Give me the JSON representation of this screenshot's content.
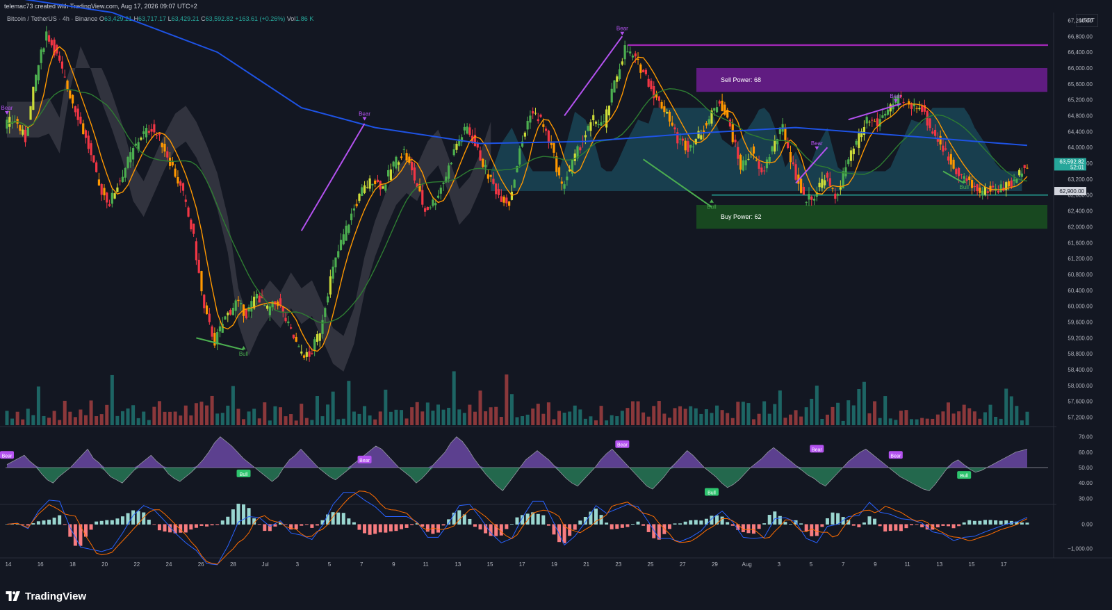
{
  "header": {
    "attribution": "telemac73 created with TradingView.com, Aug 17, 2026 09:07 UTC+2",
    "symbol": "Bitcoin / TetherUS · 4h · Binance",
    "open_label": "O",
    "open": "63,429.21",
    "high_label": "H",
    "high": "63,717.17",
    "low_label": "L",
    "low": "63,429.21",
    "close_label": "C",
    "close": "63,592.82",
    "change": "+163.61 (+0.26%)",
    "volume_label": "Vol",
    "volume": "1.86 K",
    "currency": "USDT"
  },
  "brand": {
    "name": "TradingView"
  },
  "colors": {
    "background": "#131722",
    "up": "#26a69a",
    "down": "#ef5350",
    "bull_candle": "#4caf50",
    "bear_candle": "#f23645",
    "ma_fast": "#ff9800",
    "ma_mid": "#2e7d32",
    "ma_slow": "#1e53e5",
    "divergence": "#b452f0",
    "sell_zone": "#7b1fa2",
    "buy_zone": "#1b5e20"
  },
  "chart_data": [
    {
      "type": "candlestick",
      "title": "",
      "x_ticks": [
        "14",
        "16",
        "18",
        "20",
        "22",
        "24",
        "26",
        "28",
        "Jul",
        "3",
        "5",
        "7",
        "9",
        "11",
        "13",
        "15",
        "17",
        "19",
        "21",
        "23",
        "25",
        "27",
        "29",
        "Aug",
        "3",
        "5",
        "7",
        "9",
        "11",
        "13",
        "15",
        "17"
      ],
      "y_ticks": [
        "67,200.00",
        "66,800.00",
        "66,400.00",
        "66,000.00",
        "65,600.00",
        "65,200.00",
        "64,800.00",
        "64,400.00",
        "64,000.00",
        "63,600.00",
        "63,200.00",
        "62,800.00",
        "62,400.00",
        "62,000.00",
        "61,600.00",
        "61,200.00",
        "60,800.00",
        "60,400.00",
        "60,000.00",
        "59,600.00",
        "59,200.00",
        "58,800.00",
        "58,400.00",
        "58,000.00",
        "57,600.00",
        "57,200.00"
      ],
      "ylim": [
        57000,
        67400
      ],
      "last_price": {
        "value": "63,592.82",
        "countdown": "52:01"
      },
      "level_label": "62,900.00",
      "zones": [
        {
          "name": "Sell Power: 68",
          "from": 65400,
          "to": 66000
        },
        {
          "name": "Buy Power: 62",
          "from": 61950,
          "to": 62550
        }
      ],
      "horizontal_line": 66580,
      "price_path": [
        [
          0,
          64600
        ],
        [
          2,
          64700
        ],
        [
          4,
          64200
        ],
        [
          6,
          65800
        ],
        [
          8,
          66900
        ],
        [
          10,
          66300
        ],
        [
          12,
          65500
        ],
        [
          14,
          64800
        ],
        [
          16,
          64000
        ],
        [
          18,
          63000
        ],
        [
          20,
          62600
        ],
        [
          22,
          63200
        ],
        [
          24,
          63800
        ],
        [
          26,
          64300
        ],
        [
          28,
          64500
        ],
        [
          30,
          64100
        ],
        [
          32,
          63500
        ],
        [
          34,
          62800
        ],
        [
          36,
          61700
        ],
        [
          38,
          59900
        ],
        [
          40,
          59100
        ],
        [
          42,
          59700
        ],
        [
          44,
          60100
        ],
        [
          46,
          59800
        ],
        [
          48,
          60300
        ],
        [
          50,
          59900
        ],
        [
          52,
          60100
        ],
        [
          54,
          59500
        ],
        [
          56,
          58900
        ],
        [
          58,
          58700
        ],
        [
          60,
          59400
        ],
        [
          62,
          60700
        ],
        [
          64,
          61600
        ],
        [
          66,
          62300
        ],
        [
          68,
          62900
        ],
        [
          70,
          63200
        ],
        [
          72,
          63000
        ],
        [
          74,
          63600
        ],
        [
          76,
          63900
        ],
        [
          78,
          63200
        ],
        [
          80,
          62400
        ],
        [
          82,
          62700
        ],
        [
          84,
          63300
        ],
        [
          86,
          64100
        ],
        [
          88,
          64500
        ],
        [
          90,
          63900
        ],
        [
          92,
          63300
        ],
        [
          94,
          62800
        ],
        [
          96,
          62600
        ],
        [
          98,
          63900
        ],
        [
          100,
          64900
        ],
        [
          102,
          64700
        ],
        [
          104,
          64000
        ],
        [
          106,
          63000
        ],
        [
          108,
          63600
        ],
        [
          110,
          64200
        ],
        [
          112,
          64700
        ],
        [
          114,
          64600
        ],
        [
          116,
          65600
        ],
        [
          118,
          66500
        ],
        [
          120,
          66200
        ],
        [
          122,
          65800
        ],
        [
          124,
          65200
        ],
        [
          126,
          64900
        ],
        [
          128,
          64200
        ],
        [
          130,
          64000
        ],
        [
          132,
          64300
        ],
        [
          134,
          64700
        ],
        [
          136,
          65200
        ],
        [
          138,
          64500
        ],
        [
          140,
          63500
        ],
        [
          142,
          63900
        ],
        [
          144,
          63300
        ],
        [
          146,
          64000
        ],
        [
          148,
          64500
        ],
        [
          150,
          63500
        ],
        [
          152,
          62700
        ],
        [
          154,
          62800
        ],
        [
          156,
          63300
        ],
        [
          158,
          62700
        ],
        [
          160,
          63500
        ],
        [
          162,
          64100
        ],
        [
          164,
          64700
        ],
        [
          166,
          64600
        ],
        [
          168,
          65000
        ],
        [
          170,
          65200
        ],
        [
          172,
          65000
        ],
        [
          174,
          65100
        ],
        [
          176,
          64500
        ],
        [
          178,
          64100
        ],
        [
          180,
          63600
        ],
        [
          182,
          63300
        ],
        [
          184,
          63000
        ],
        [
          186,
          62900
        ],
        [
          188,
          62950
        ],
        [
          190,
          63000
        ],
        [
          192,
          63100
        ],
        [
          194,
          63593
        ]
      ],
      "labels": [
        {
          "text": "Bear",
          "x": 0,
          "y": 64950
        },
        {
          "text": "Bear",
          "x": 68,
          "y": 64800
        },
        {
          "text": "Bear",
          "x": 117,
          "y": 66950
        },
        {
          "text": "Bear",
          "x": 154,
          "y": 64060
        },
        {
          "text": "Bear",
          "x": 169,
          "y": 65250
        },
        {
          "text": "Bull",
          "x": 45,
          "y": 58750
        },
        {
          "text": "Bull",
          "x": 134,
          "y": 62450
        },
        {
          "text": "Bull",
          "x": 182,
          "y": 62950
        }
      ]
    },
    {
      "type": "area",
      "title": "",
      "y_ticks": [
        "70.00",
        "60.00",
        "50.00",
        "40.00",
        "30.00"
      ],
      "ylim": [
        27,
        73
      ],
      "baseline": 50,
      "values": [
        52,
        54,
        56,
        58,
        54,
        51,
        46,
        42,
        40,
        44,
        47,
        50,
        54,
        58,
        62,
        56,
        53,
        48,
        44,
        42,
        40,
        44,
        48,
        52,
        55,
        58,
        54,
        51,
        46,
        43,
        41,
        44,
        47,
        51,
        55,
        60,
        66,
        70,
        67,
        64,
        60,
        56,
        53,
        50,
        47,
        44,
        41,
        44,
        50,
        55,
        58,
        62,
        58,
        54,
        50,
        47,
        44,
        42,
        45,
        48,
        52,
        55,
        58,
        61,
        64,
        62,
        58,
        54,
        50,
        47,
        44,
        40,
        43,
        47,
        52,
        56,
        60,
        66,
        70,
        67,
        62,
        56,
        51,
        46,
        42,
        38,
        35,
        40,
        45,
        50,
        55,
        58,
        61,
        58,
        55,
        51,
        47,
        43,
        40,
        38,
        42,
        46,
        50,
        55,
        59,
        62,
        58,
        54,
        50,
        46,
        42,
        38,
        36,
        40,
        44,
        49,
        53,
        57,
        61,
        58,
        54,
        50,
        47,
        44,
        40,
        37,
        39,
        42,
        46,
        50,
        53,
        56,
        60,
        63,
        60,
        57,
        54,
        51,
        48,
        45,
        43,
        40,
        38,
        42,
        46,
        50,
        54,
        57,
        60,
        62,
        59,
        56,
        53,
        50,
        47,
        44,
        42,
        40,
        38,
        36,
        35,
        39,
        44,
        49,
        53,
        55,
        52,
        49,
        47,
        48,
        50,
        52,
        54,
        56,
        58,
        60,
        61,
        62
      ],
      "labels": [
        {
          "text": "Bear",
          "x": 0,
          "y": 58
        },
        {
          "text": "Bull",
          "x": 45,
          "y": 46
        },
        {
          "text": "Bear",
          "x": 68,
          "y": 55
        },
        {
          "text": "Bear",
          "x": 117,
          "y": 65
        },
        {
          "text": "Bull",
          "x": 134,
          "y": 34
        },
        {
          "text": "Bear",
          "x": 154,
          "y": 62
        },
        {
          "text": "Bear",
          "x": 169,
          "y": 58
        },
        {
          "text": "Bull",
          "x": 182,
          "y": 45
        }
      ]
    },
    {
      "type": "bar",
      "title": "",
      "y_ticks": [
        "0.00",
        "−1,000.00"
      ],
      "ylim": [
        -1300,
        700
      ],
      "zero": 0
    }
  ]
}
